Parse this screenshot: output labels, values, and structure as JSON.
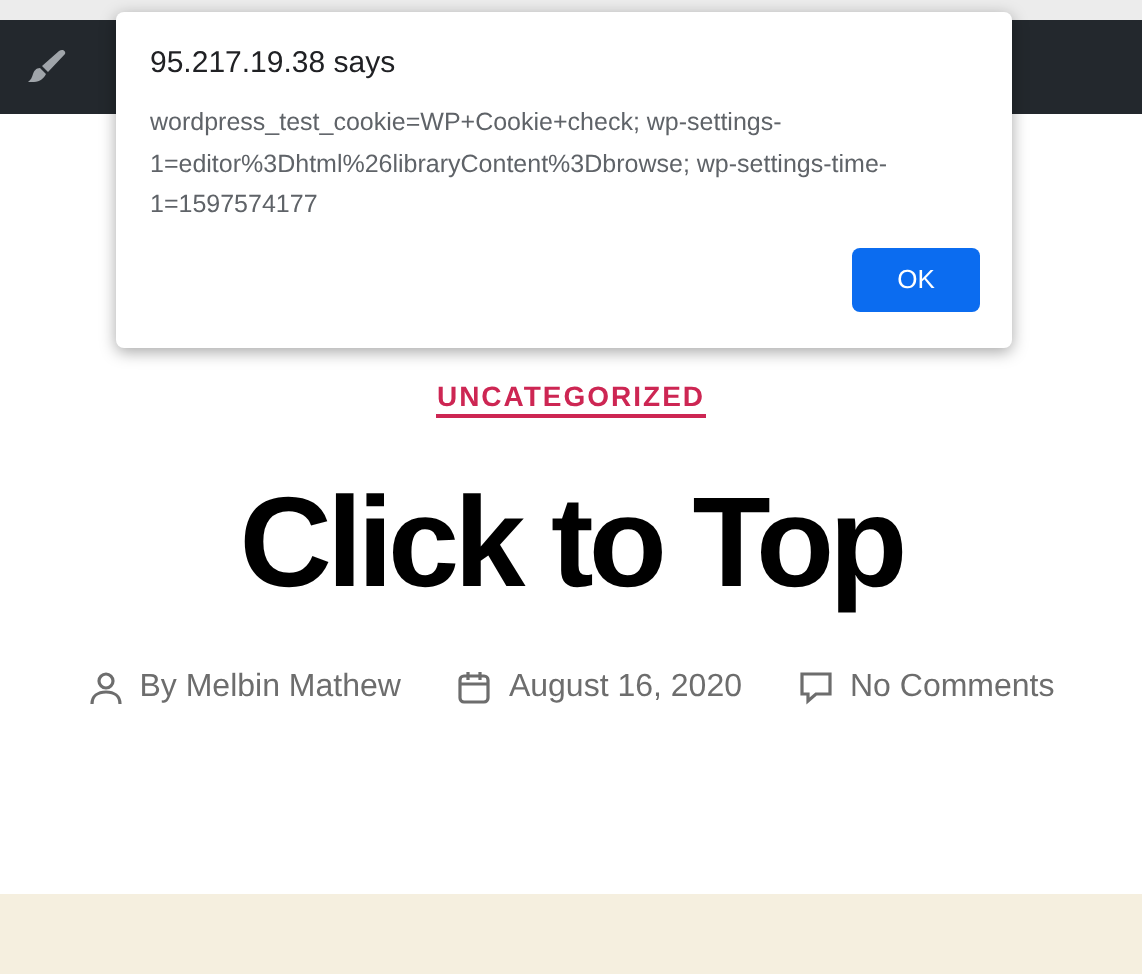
{
  "dialog": {
    "title": "95.217.19.38 says",
    "message": "wordpress_test_cookie=WP+Cookie+check; wp-settings-1=editor%3Dhtml%26libraryContent%3Dbrowse; wp-settings-time-1=1597574177",
    "button": "OK"
  },
  "post": {
    "category": "UNCATEGORIZED",
    "title": "Click to Top",
    "meta": [
      {
        "kind": "author",
        "text": "By Melbin Mathew"
      },
      {
        "kind": "date",
        "text": "August 16, 2020"
      },
      {
        "kind": "comments",
        "text": "No Comments"
      }
    ]
  }
}
